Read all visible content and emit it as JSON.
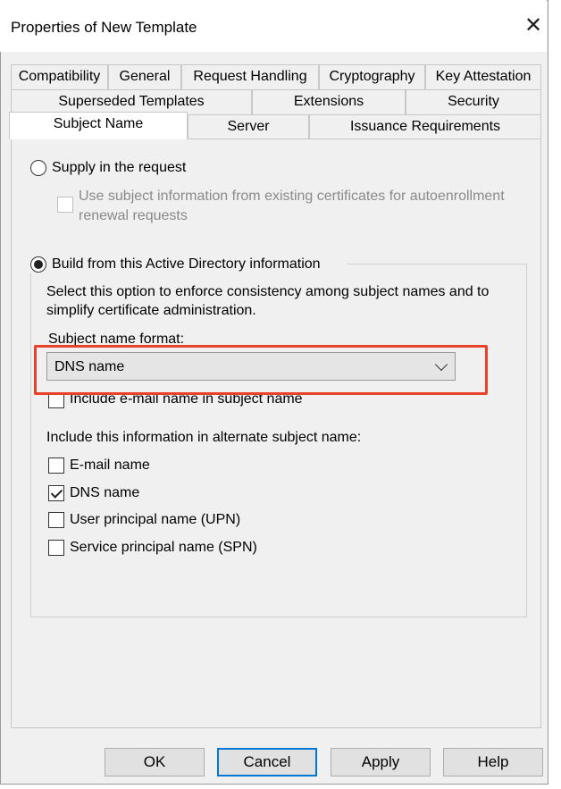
{
  "window": {
    "title": "Properties of New Template"
  },
  "tabs": {
    "row1": [
      "Compatibility",
      "General",
      "Request Handling",
      "Cryptography",
      "Key Attestation"
    ],
    "row2": [
      "Superseded Templates",
      "Extensions",
      "Security"
    ],
    "row3": [
      "Subject Name",
      "Server",
      "Issuance Requirements"
    ],
    "active": "Subject Name"
  },
  "subject_name": {
    "supply_label": "Supply in the request",
    "supply_selected": false,
    "autoenroll_line1": "Use subject information from existing certificates for autoenrollment",
    "autoenroll_line2": "renewal requests",
    "autoenroll_checked": false,
    "build_label": "Build from this Active Directory information",
    "build_selected": true,
    "description_line1": "Select this option to enforce consistency among subject names and to",
    "description_line2": "simplify certificate administration.",
    "format_label": "Subject name format:",
    "format_value": "DNS name",
    "include_email_subject": "Include e-mail name in subject name",
    "include_email_subject_checked": false,
    "alt_heading": "Include this information in alternate subject name:",
    "alt_options": [
      {
        "label": "E-mail name",
        "checked": false
      },
      {
        "label": "DNS name",
        "checked": true
      },
      {
        "label": "User principal name (UPN)",
        "checked": false
      },
      {
        "label": "Service principal name (SPN)",
        "checked": false
      }
    ]
  },
  "buttons": {
    "ok": "OK",
    "cancel": "Cancel",
    "apply": "Apply",
    "help": "Help"
  },
  "colors": {
    "highlight": "#e8412c",
    "default_button_border": "#0078d7"
  },
  "icons": {
    "close": "close-icon",
    "dropdown": "chevron-down-icon"
  }
}
